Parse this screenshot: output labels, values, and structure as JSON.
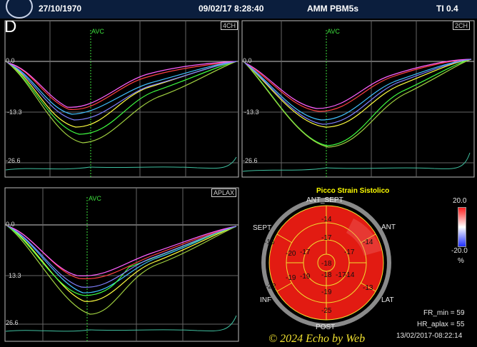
{
  "header": {
    "date_of_birth": "27/10/1970",
    "datetime": "09/02/17 8:28:40",
    "probe": "AMM PBM5s",
    "ti": "TI 0.4"
  },
  "panel_label": "D",
  "panels": [
    {
      "view": "4CH",
      "marker": "AVC",
      "y_labels": [
        "0.0",
        "-13.3",
        "-26.6"
      ]
    },
    {
      "view": "2CH",
      "marker": "AVC",
      "y_labels": [
        "0.0",
        "-13.3",
        "-26.6"
      ]
    },
    {
      "view": "APLAX",
      "marker": "AVC",
      "y_labels": [
        "0.0",
        "13.3",
        "26.6"
      ]
    }
  ],
  "bullseye": {
    "title": "Picco Strain Sistolico",
    "labels": {
      "ant_sept": "ANT_SEPT",
      "ant": "ANT",
      "sept": "SEPT",
      "lat": "LAT",
      "inf": "INF",
      "post": "POST"
    },
    "segment_values": [
      "-14",
      "-17",
      "-17",
      "-17",
      "-18",
      "-14",
      "-14",
      "-19",
      "-19",
      "-22",
      "-25",
      "-13",
      "-16",
      "-20",
      "-19",
      "-17",
      "-18"
    ],
    "scale": {
      "max": "20.0",
      "min": "-20.0",
      "unit": "%"
    },
    "colors": {
      "strain_red": "#e21b12",
      "scale_top": "#ff2020",
      "scale_bottom": "#2030ff"
    }
  },
  "stats": {
    "fr_min": "FR_min = 59",
    "hr_aplax": "HR_aplax = 55",
    "timestamp": "13/02/2017-08:22:14"
  },
  "copyright": "© 2024 Echo by Web"
}
